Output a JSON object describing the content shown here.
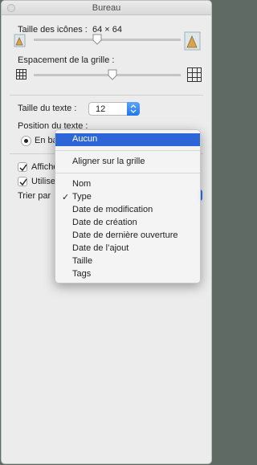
{
  "window": {
    "title": "Bureau"
  },
  "icon_size": {
    "label": "Taille des icônes :",
    "value": "64 × 64",
    "level": 0.5
  },
  "grid_spacing": {
    "label": "Espacement de la grille :",
    "level": 0.55
  },
  "text_size": {
    "label": "Taille du texte :",
    "value": "12"
  },
  "text_position": {
    "label": "Position du texte :",
    "option_bottom": "En bas"
  },
  "options": {
    "show_info": "Afficher",
    "use_preview": "Utiliser",
    "sort_by": "Trier par"
  },
  "menu": {
    "items": [
      {
        "label": "Aucun",
        "highlighted": true
      },
      {
        "label": "Aligner sur la grille"
      },
      {
        "label": "Nom"
      },
      {
        "label": "Type",
        "checked": true
      },
      {
        "label": "Date de modification"
      },
      {
        "label": "Date de création"
      },
      {
        "label": "Date de dernière ouverture"
      },
      {
        "label": "Date de l’ajout"
      },
      {
        "label": "Taille"
      },
      {
        "label": "Tags"
      }
    ]
  },
  "colors": {
    "highlight": "#2f66d7",
    "popup_accent": "#1f77ec"
  }
}
